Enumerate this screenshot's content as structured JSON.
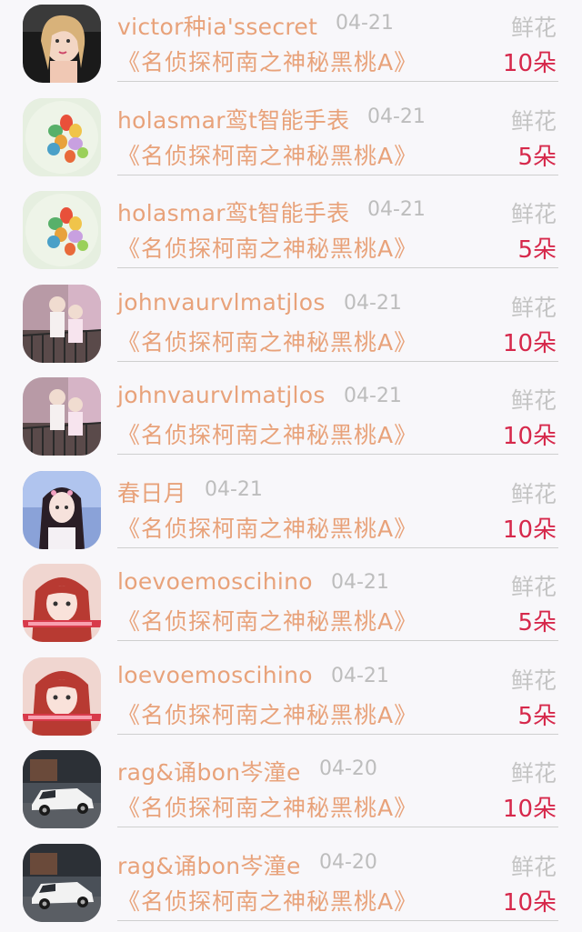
{
  "records": [
    {
      "name": "victor种ia'ssecret",
      "date": "04-21",
      "gift": "《名侦探柯南之神秘黑桃A》",
      "type": "鲜花",
      "count": "10朵",
      "avatar": "avatar-girl-selfie"
    },
    {
      "name": "holasmar鸾t智能手表",
      "date": "04-21",
      "gift": "《名侦探柯南之神秘黑桃A》",
      "type": "鲜花",
      "count": "5朵",
      "avatar": "avatar-balloons"
    },
    {
      "name": "holasmar鸾t智能手表",
      "date": "04-21",
      "gift": "《名侦探柯南之神秘黑桃A》",
      "type": "鲜花",
      "count": "5朵",
      "avatar": "avatar-balloons"
    },
    {
      "name": "johnvaurvlmatjlos",
      "date": "04-21",
      "gift": "《名侦探柯南之神秘黑桃A》",
      "type": "鲜花",
      "count": "10朵",
      "avatar": "avatar-couple"
    },
    {
      "name": "johnvaurvlmatjlos",
      "date": "04-21",
      "gift": "《名侦探柯南之神秘黑桃A》",
      "type": "鲜花",
      "count": "10朵",
      "avatar": "avatar-couple"
    },
    {
      "name": "春日月",
      "date": "04-21",
      "gift": "《名侦探柯南之神秘黑桃A》",
      "type": "鲜花",
      "count": "10朵",
      "avatar": "avatar-girl-costume"
    },
    {
      "name": "loevoemoscihino",
      "date": "04-21",
      "gift": "《名侦探柯南之神秘黑桃A》",
      "type": "鲜花",
      "count": "5朵",
      "avatar": "avatar-girl-red-hair"
    },
    {
      "name": "loevoemoscihino",
      "date": "04-21",
      "gift": "《名侦探柯南之神秘黑桃A》",
      "type": "鲜花",
      "count": "5朵",
      "avatar": "avatar-girl-red-hair"
    },
    {
      "name": "rag&诵bon岑潼e",
      "date": "04-20",
      "gift": "《名侦探柯南之神秘黑桃A》",
      "type": "鲜花",
      "count": "10朵",
      "avatar": "avatar-car"
    },
    {
      "name": "rag&诵bon岑潼e",
      "date": "04-20",
      "gift": "《名侦探柯南之神秘黑桃A》",
      "type": "鲜花",
      "count": "10朵",
      "avatar": "avatar-car"
    }
  ],
  "colors": {
    "name": "#e8a27a",
    "date": "#bdbdbd",
    "type": "#c4c4c4",
    "count": "#d6284b",
    "background": "#f8f7fa"
  }
}
